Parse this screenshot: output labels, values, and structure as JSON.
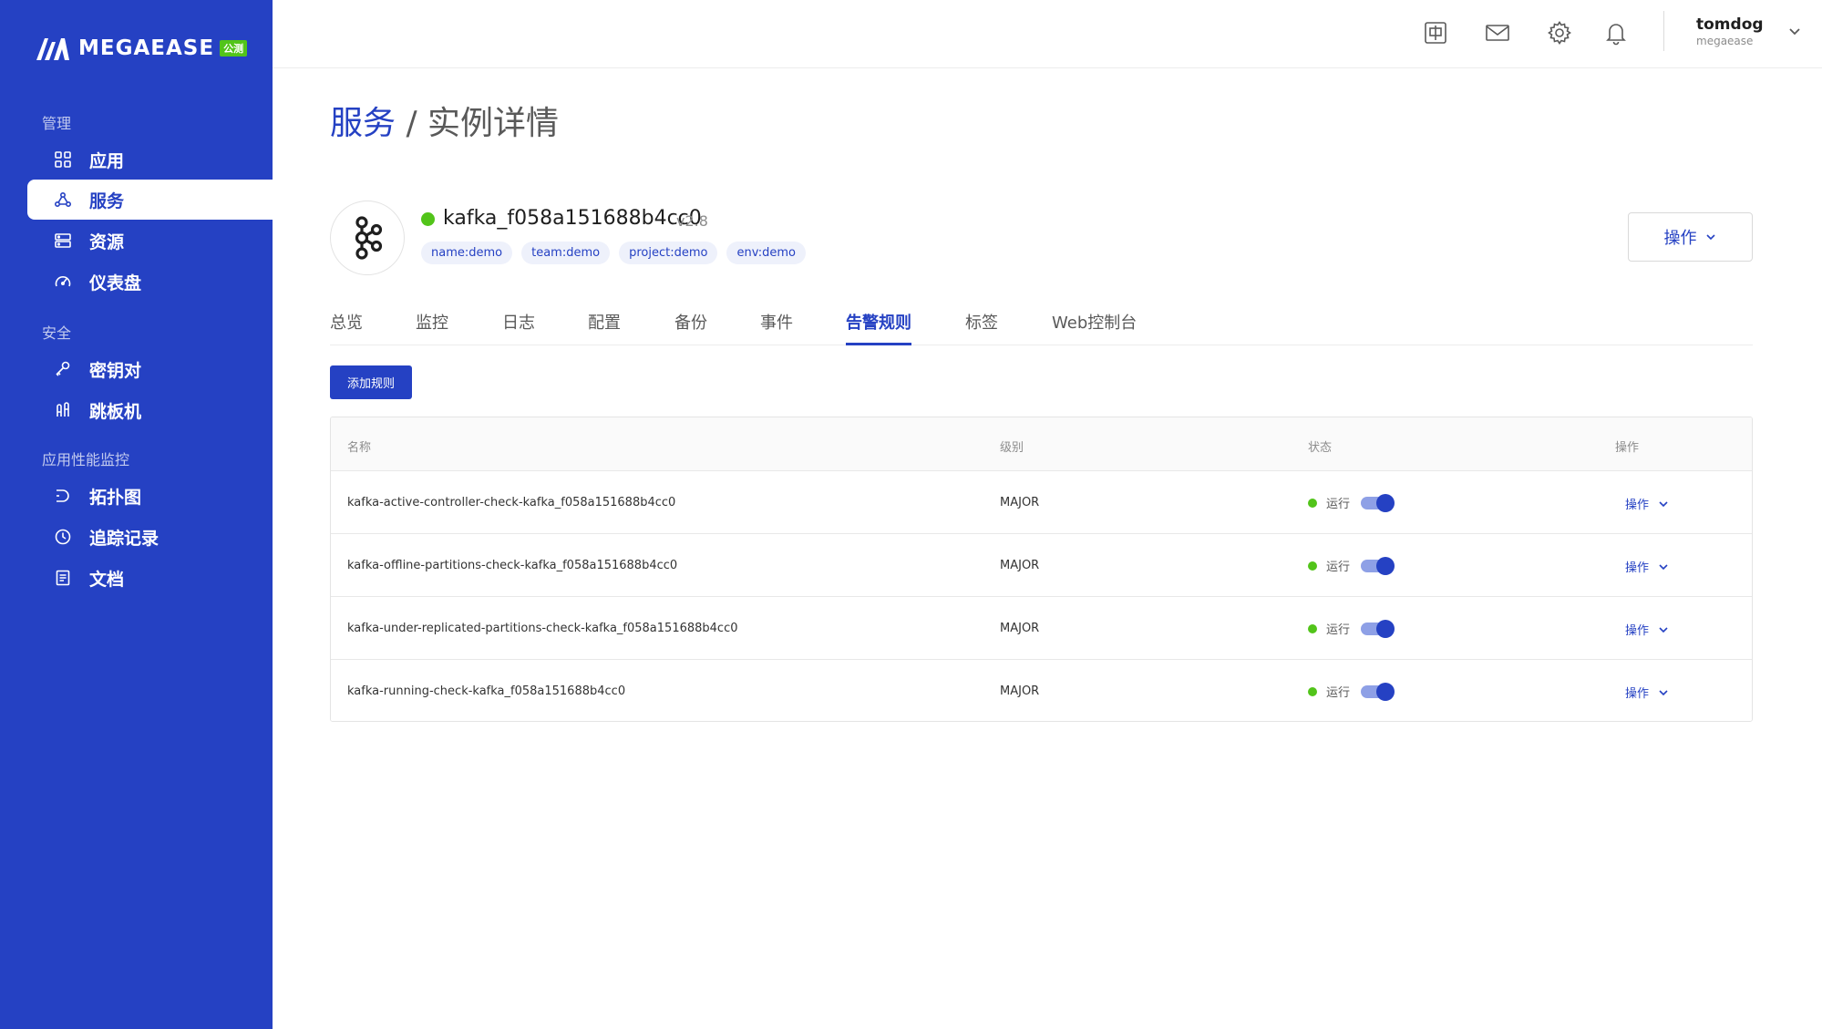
{
  "brand": {
    "name": "MEGAEASE",
    "badge": "公测"
  },
  "sidebar": {
    "groups": [
      {
        "title": "管理",
        "items": [
          {
            "label": "应用",
            "icon": "grid-icon"
          },
          {
            "label": "服务",
            "icon": "cluster-icon",
            "active": true
          },
          {
            "label": "资源",
            "icon": "server-icon"
          },
          {
            "label": "仪表盘",
            "icon": "gauge-icon"
          }
        ]
      },
      {
        "title": "安全",
        "items": [
          {
            "label": "密钥对",
            "icon": "key-icon"
          },
          {
            "label": "跳板机",
            "icon": "jump-icon"
          }
        ]
      },
      {
        "title": "应用性能监控",
        "items": [
          {
            "label": "拓扑图",
            "icon": "topology-icon"
          },
          {
            "label": "追踪记录",
            "icon": "clock-icon"
          },
          {
            "label": "文档",
            "icon": "document-icon"
          }
        ]
      }
    ]
  },
  "topbar": {
    "icons": [
      "language-icon",
      "mail-icon",
      "settings-icon",
      "bell-icon"
    ],
    "user": {
      "name": "tomdog",
      "org": "megaease"
    }
  },
  "page": {
    "breadcrumb": "服务",
    "separator": " / ",
    "title": "实例详情"
  },
  "instance": {
    "name": "kafka_f058a151688b4cc0",
    "version": "v2.8",
    "status_color": "#52c41a",
    "tags": [
      "name:demo",
      "team:demo",
      "project:demo",
      "env:demo"
    ],
    "ops_label": "操作"
  },
  "tabs": [
    {
      "label": "总览"
    },
    {
      "label": "监控"
    },
    {
      "label": "日志"
    },
    {
      "label": "配置"
    },
    {
      "label": "备份"
    },
    {
      "label": "事件"
    },
    {
      "label": "告警规则",
      "active": true
    },
    {
      "label": "标签"
    },
    {
      "label": "Web控制台"
    }
  ],
  "toolbar": {
    "add_label": "添加规则"
  },
  "table": {
    "headers": {
      "name": "名称",
      "level": "级别",
      "status": "状态",
      "ops": "操作"
    },
    "rows": [
      {
        "name": "kafka-active-controller-check-kafka_f058a151688b4cc0",
        "level": "MAJOR",
        "status": "运行",
        "enabled": true,
        "ops": "操作"
      },
      {
        "name": "kafka-offline-partitions-check-kafka_f058a151688b4cc0",
        "level": "MAJOR",
        "status": "运行",
        "enabled": true,
        "ops": "操作"
      },
      {
        "name": "kafka-under-replicated-partitions-check-kafka_f058a151688b4cc0",
        "level": "MAJOR",
        "status": "运行",
        "enabled": true,
        "ops": "操作"
      },
      {
        "name": "kafka-running-check-kafka_f058a151688b4cc0",
        "level": "MAJOR",
        "status": "运行",
        "enabled": true,
        "ops": "操作"
      }
    ]
  },
  "colors": {
    "primary": "#2541c3",
    "success": "#52c41a"
  }
}
